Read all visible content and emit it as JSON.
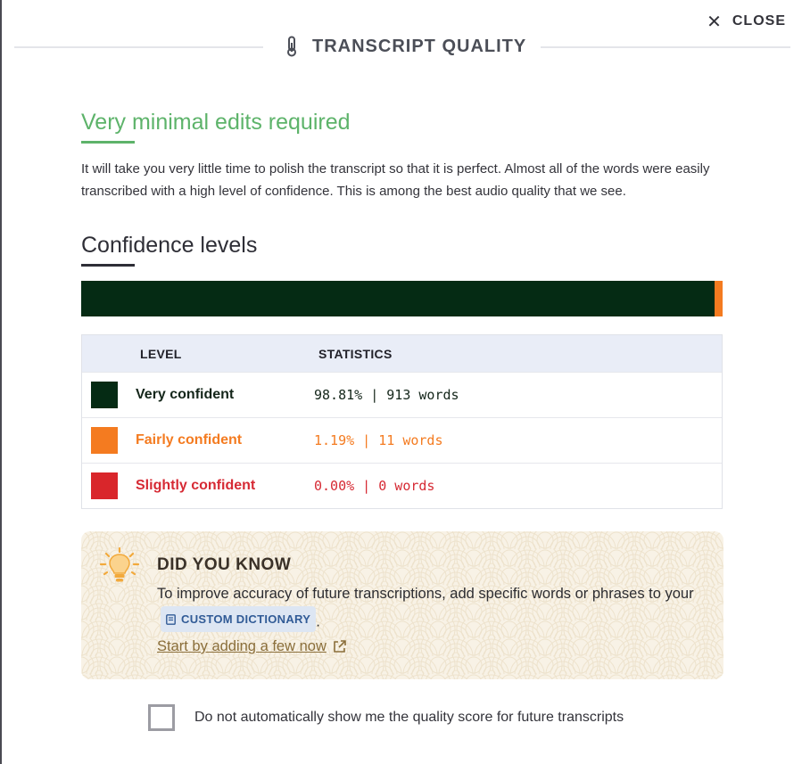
{
  "header": {
    "title": "TRANSCRIPT QUALITY",
    "icon": "thermometer-icon",
    "close_label": "CLOSE",
    "close_icon": "close-icon"
  },
  "summary": {
    "title": "Very minimal edits required",
    "text": "It will take you very little time to polish the transcript so that it is perfect. Almost all of the words were easily transcribed with a high level of confidence. This is among the best audio quality that we see.",
    "accent_color": "#5db36a"
  },
  "confidence": {
    "title": "Confidence levels",
    "bar": [
      {
        "level": "Very confident",
        "fraction": 0.9881,
        "color": "#052b14"
      },
      {
        "level": "Fairly confident",
        "fraction": 0.0119,
        "color": "#f47b20"
      },
      {
        "level": "Slightly confident",
        "fraction": 0.0,
        "color": "#d9262b"
      }
    ],
    "table": {
      "col_level": "LEVEL",
      "col_stats": "STATISTICS",
      "rows": [
        {
          "name": "Very confident",
          "stat": "98.81% | 913 words",
          "color": "#052b14",
          "text_color": "#14261a"
        },
        {
          "name": "Fairly confident",
          "stat": "1.19% | 11 words",
          "color": "#f47b20",
          "text_color": "#f47b20"
        },
        {
          "name": "Slightly confident",
          "stat": "0.00% | 0 words",
          "color": "#d9262b",
          "text_color": "#d62a34"
        }
      ]
    }
  },
  "tip": {
    "icon": "lightbulb-icon",
    "heading": "DID YOU KNOW",
    "text_before": "To improve accuracy of future transcriptions, add specific words or phrases to your",
    "chip_label": "CUSTOM DICTIONARY",
    "chip_icon": "book-icon",
    "text_after": ".",
    "link_label": "Start by adding a few now",
    "link_icon": "external-link-icon"
  },
  "option": {
    "label": "Do not automatically show me the quality score for future transcripts",
    "checked": false
  }
}
